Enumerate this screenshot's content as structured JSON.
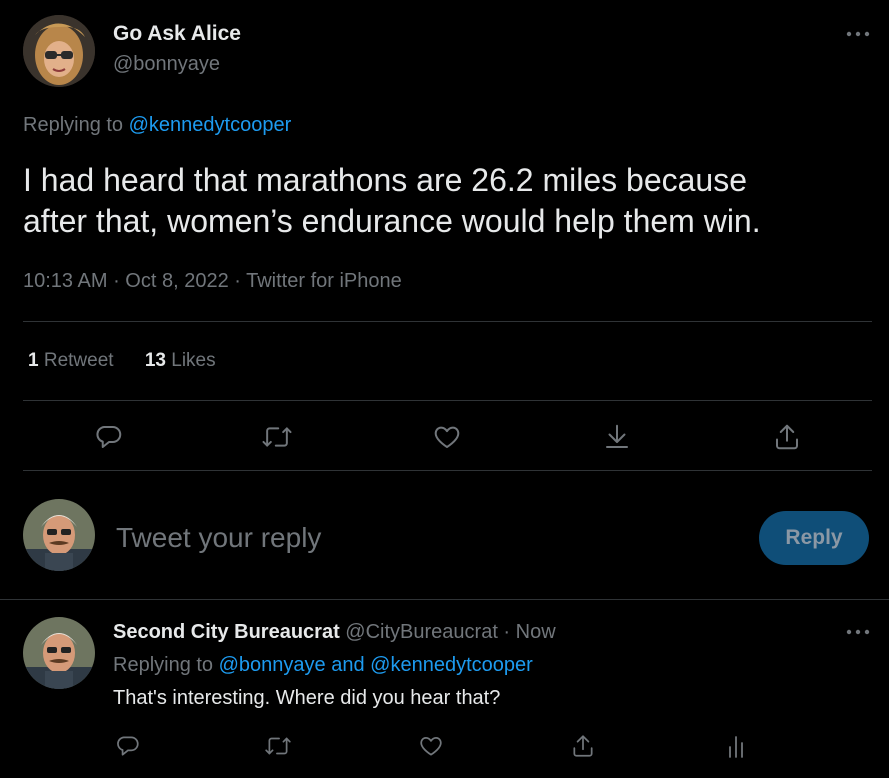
{
  "main_tweet": {
    "author_name": "Go Ask Alice",
    "author_handle": "@bonnyaye",
    "replying_prefix": "Replying to ",
    "replying_to": "@kennedytcooper",
    "text_line1": "I had heard that marathons are 26.2 miles because",
    "text_line2": "after that, women’s endurance would help them win.",
    "time": "10:13 AM",
    "sep1": " · ",
    "date": "Oct 8, 2022",
    "sep2": " · ",
    "source": "Twitter for iPhone",
    "retweet_count": "1",
    "retweet_label": " Retweet",
    "like_count": "13",
    "like_label": " Likes"
  },
  "reply_box": {
    "placeholder": "Tweet your reply",
    "button_label": "Reply"
  },
  "reply_tweet": {
    "author_name": "Second City Bureaucrat",
    "author_handle": "@CityBureaucrat",
    "sep": " · ",
    "time": "Now",
    "replying_prefix": "Replying to ",
    "replying_to_1": "@bonnyaye",
    "replying_and": " and ",
    "replying_to_2": "@kennedytcooper",
    "text": "That's interesting. Where did you hear that?"
  },
  "icons": {
    "reply": "speech-bubble-icon",
    "retweet": "retweet-icon",
    "like": "heart-icon",
    "bookmark": "download-icon",
    "share": "share-icon",
    "analytics": "analytics-icon",
    "more": "more-dots-icon"
  },
  "colors": {
    "background": "#000000",
    "text": "#e7e9ea",
    "muted": "#71767b",
    "accent": "#1d9bf0",
    "reply_button_bg": "#0f4e78",
    "reply_button_text": "#8b98a5",
    "divider": "#2f3336"
  }
}
